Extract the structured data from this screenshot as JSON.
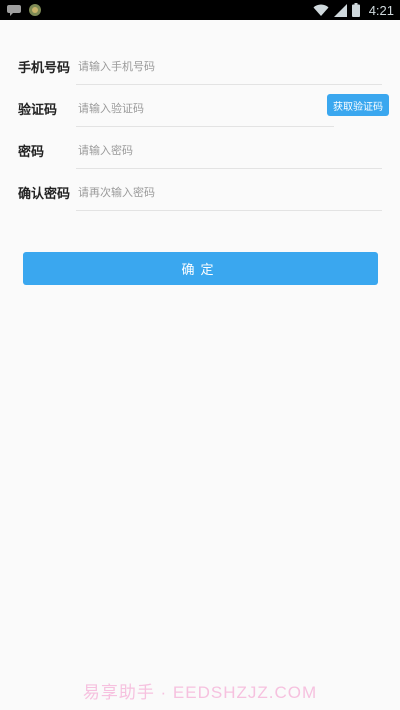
{
  "status_bar": {
    "time": "4:21",
    "icons": [
      "chat-icon",
      "app-badge-icon",
      "wifi-icon",
      "signal-icon",
      "battery-icon"
    ]
  },
  "form": {
    "phone": {
      "label": "手机号码",
      "placeholder": "请输入手机号码",
      "value": ""
    },
    "code": {
      "label": "验证码",
      "placeholder": "请输入验证码",
      "value": "",
      "button_label": "获取验证码"
    },
    "password": {
      "label": "密码",
      "placeholder": "请输入密码",
      "value": ""
    },
    "confirm_password": {
      "label": "确认密码",
      "placeholder": "请再次输入密码",
      "value": ""
    }
  },
  "confirm_button": {
    "label": "确定"
  },
  "watermark": {
    "text": "易享助手 · EEDSHZJZ.COM"
  },
  "colors": {
    "accent": "#3aa7ef",
    "background": "#fafafa",
    "status_bar": "#000000",
    "label": "#222222",
    "placeholder": "#9a9a9a"
  }
}
